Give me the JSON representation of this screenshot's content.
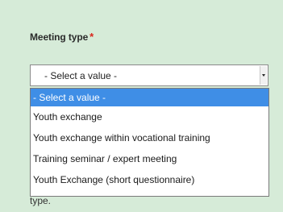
{
  "field": {
    "label": "Meeting type",
    "required_marker": "*"
  },
  "select": {
    "current_value": "- Select a value -"
  },
  "dropdown": {
    "options": [
      {
        "label": "- Select a value -",
        "selected": true
      },
      {
        "label": "Youth exchange",
        "selected": false
      },
      {
        "label": "Youth exchange within vocational training",
        "selected": false
      },
      {
        "label": "Training seminar / expert meeting",
        "selected": false
      },
      {
        "label": "Youth Exchange (short questionnaire)",
        "selected": false
      }
    ]
  },
  "helper": {
    "text_fragment": "type."
  },
  "colors": {
    "background": "#d6ebd8",
    "required": "#d9261c",
    "highlight": "#3f8ee6"
  }
}
